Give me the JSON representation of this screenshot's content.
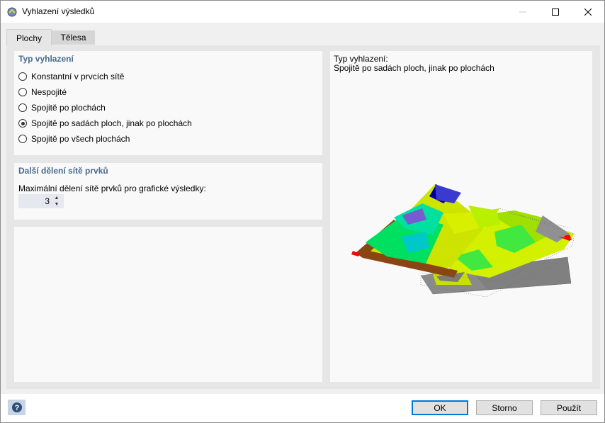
{
  "window": {
    "title": "Vyhlazení výsledků"
  },
  "tabs": [
    {
      "label": "Plochy"
    },
    {
      "label": "Tělesa"
    }
  ],
  "smoothing_type": {
    "title": "Typ vyhlazení",
    "options": [
      {
        "label": "Konstantní v prvcích sítě",
        "checked": false
      },
      {
        "label": "Nespojité",
        "checked": false
      },
      {
        "label": "Spojitě po plochách",
        "checked": false
      },
      {
        "label": "Spojitě po sadách ploch, jinak po plochách",
        "checked": true
      },
      {
        "label": "Spojitě po všech plochách",
        "checked": false
      }
    ]
  },
  "mesh_division": {
    "title": "Další dělení sítě prvků",
    "label": "Maximální dělení sítě prvků pro grafické výsledky:",
    "value": "3"
  },
  "preview": {
    "heading": "Typ vyhlazení:",
    "value": "Spojitě po sadách ploch, jinak po plochách"
  },
  "footer": {
    "ok_label": "OK",
    "cancel_label": "Storno",
    "apply_label": "Použít"
  },
  "colors": {
    "accent": "#0078d7",
    "section_title": "#4a6b8c"
  }
}
